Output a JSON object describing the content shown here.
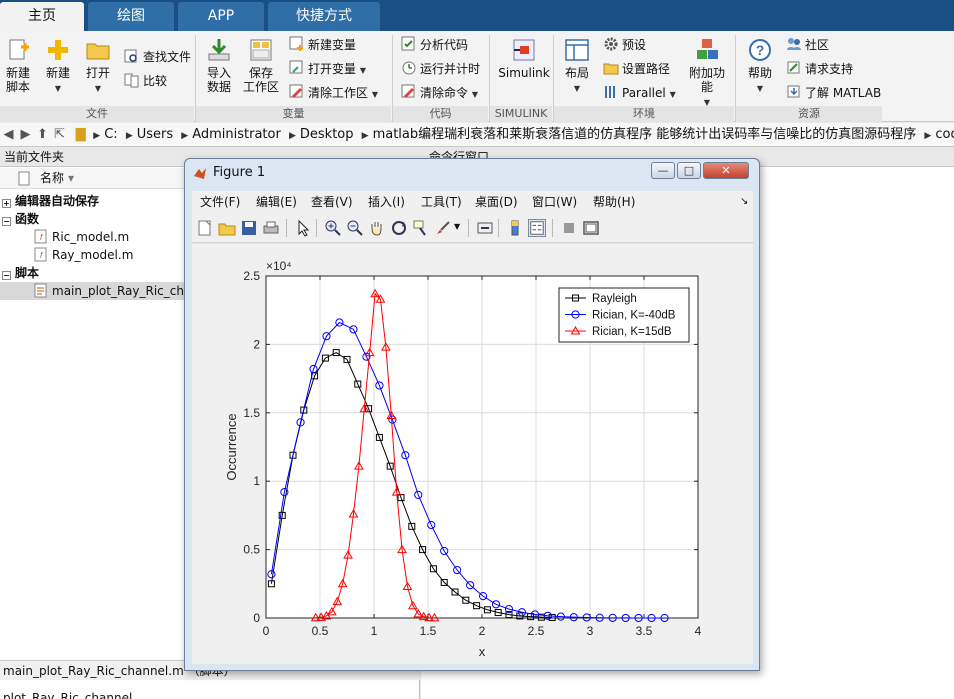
{
  "tabs": [
    {
      "label": "主页"
    },
    {
      "label": "绘图"
    },
    {
      "label": "APP"
    },
    {
      "label": "快捷方式"
    }
  ],
  "ribbon": {
    "new_script": "新建\n脚本",
    "new_script_l1": "新建",
    "new_script_l2": "脚本",
    "new": "新建",
    "open": "打开",
    "find_files": "查找文件",
    "compare": "比较",
    "import_l1": "导入",
    "import_l2": "数据",
    "save_ws_l1": "保存",
    "save_ws_l2": "工作区",
    "new_var": "新建变量",
    "open_var": "打开变量",
    "clear_ws": "清除工作区",
    "analyze_code": "分析代码",
    "run_time": "运行并计时",
    "clear_cmd": "清除命令",
    "simulink": "Simulink",
    "layout": "布局",
    "preferences": "预设",
    "set_path": "设置路径",
    "parallel": "Parallel",
    "addons": "附加功能",
    "help": "帮助",
    "community": "社区",
    "support": "请求支持",
    "learn": "了解 MATLAB",
    "groups": {
      "file": "文件",
      "variable": "变量",
      "code": "代码",
      "simulink": "SIMULINK",
      "environment": "环境",
      "resources": "资源"
    }
  },
  "address": {
    "crumbs": [
      "C:",
      "Users",
      "Administrator",
      "Desktop",
      "matlab编程瑞利衰落和莱斯衰落信道的仿真程序 能够统计出误码率与信噪比的仿真图源码程序",
      "code"
    ]
  },
  "left_pane": {
    "title": "当前文件夹",
    "column_name": "名称",
    "sort_arrow": "▾",
    "tree": [
      {
        "label": "编辑器自动保存",
        "bold": true,
        "expander": "+"
      },
      {
        "label": "函数",
        "bold": true,
        "expander": "−"
      },
      {
        "label": "Ric_model.m",
        "bold": false
      },
      {
        "label": "Ray_model.m",
        "bold": false
      },
      {
        "label": "脚本",
        "bold": true,
        "expander": "−"
      },
      {
        "label": "main_plot_Ray_Ric_channel.m",
        "bold": false,
        "selected": true
      }
    ],
    "status": "main_plot_Ray_Ric_channel.m （脚本）",
    "status_detail": "plot_Ray_Ric_channel"
  },
  "right_pane": {
    "title": "命令行窗口"
  },
  "figure": {
    "title": "Figure 1",
    "menus": [
      "文件(F)",
      "编辑(E)",
      "查看(V)",
      "插入(I)",
      "工具(T)",
      "桌面(D)",
      "窗口(W)",
      "帮助(H)"
    ],
    "minimize_glyph": "—",
    "maximize_glyph": "□",
    "close_glyph": "✕"
  },
  "chart_data": {
    "type": "line",
    "title": "",
    "xlabel": "x",
    "ylabel": "Occurrence",
    "y_exponent_label": "×10⁴",
    "xlim": [
      0,
      4
    ],
    "ylim": [
      0,
      25000
    ],
    "xticks": [
      0,
      0.5,
      1,
      1.5,
      2,
      2.5,
      3,
      3.5,
      4
    ],
    "yticks": [
      0,
      5000,
      10000,
      15000,
      20000,
      25000
    ],
    "yticklabels": [
      "0",
      "0.5",
      "1",
      "1.5",
      "2",
      "2.5"
    ],
    "grid": true,
    "legend_position": "top-right",
    "series": [
      {
        "name": "Rayleigh",
        "color": "#000000",
        "marker": "square",
        "x": [
          0.05,
          0.15,
          0.25,
          0.35,
          0.45,
          0.55,
          0.65,
          0.75,
          0.85,
          0.95,
          1.05,
          1.15,
          1.25,
          1.35,
          1.45,
          1.55,
          1.65,
          1.75,
          1.85,
          1.95,
          2.05,
          2.15,
          2.25,
          2.35,
          2.45,
          2.55,
          2.65
        ],
        "y": [
          2500,
          7500,
          11900,
          15200,
          17700,
          19000,
          19400,
          18900,
          17100,
          15300,
          13200,
          11100,
          8800,
          6700,
          5000,
          3600,
          2600,
          1900,
          1300,
          900,
          600,
          400,
          250,
          150,
          100,
          60,
          40
        ]
      },
      {
        "name": "Rician, K=-40dB",
        "color": "#0000ff",
        "marker": "circle",
        "x": [
          0.05,
          0.17,
          0.32,
          0.44,
          0.56,
          0.68,
          0.81,
          0.93,
          1.05,
          1.17,
          1.29,
          1.41,
          1.53,
          1.65,
          1.77,
          1.89,
          2.01,
          2.13,
          2.25,
          2.37,
          2.49,
          2.61,
          2.73,
          2.85,
          2.97,
          3.09,
          3.21,
          3.33,
          3.45,
          3.57,
          3.69
        ],
        "y": [
          3200,
          9200,
          14300,
          18200,
          20600,
          21600,
          21100,
          19100,
          17000,
          14500,
          11900,
          9000,
          6800,
          4900,
          3500,
          2400,
          1600,
          1000,
          650,
          420,
          260,
          160,
          100,
          60,
          40,
          20,
          10,
          5,
          3,
          2,
          1
        ]
      },
      {
        "name": "Rician, K=15dB",
        "color": "#ff0000",
        "marker": "triangle",
        "x": [
          0.46,
          0.51,
          0.56,
          0.61,
          0.66,
          0.71,
          0.76,
          0.81,
          0.86,
          0.91,
          0.96,
          1.01,
          1.06,
          1.11,
          1.16,
          1.21,
          1.26,
          1.31,
          1.36,
          1.41,
          1.46,
          1.51,
          1.56
        ],
        "y": [
          20,
          50,
          150,
          450,
          1200,
          2500,
          4600,
          7600,
          11100,
          15300,
          19400,
          23700,
          23300,
          19800,
          14800,
          9200,
          5000,
          2300,
          900,
          300,
          100,
          30,
          10
        ]
      }
    ]
  }
}
